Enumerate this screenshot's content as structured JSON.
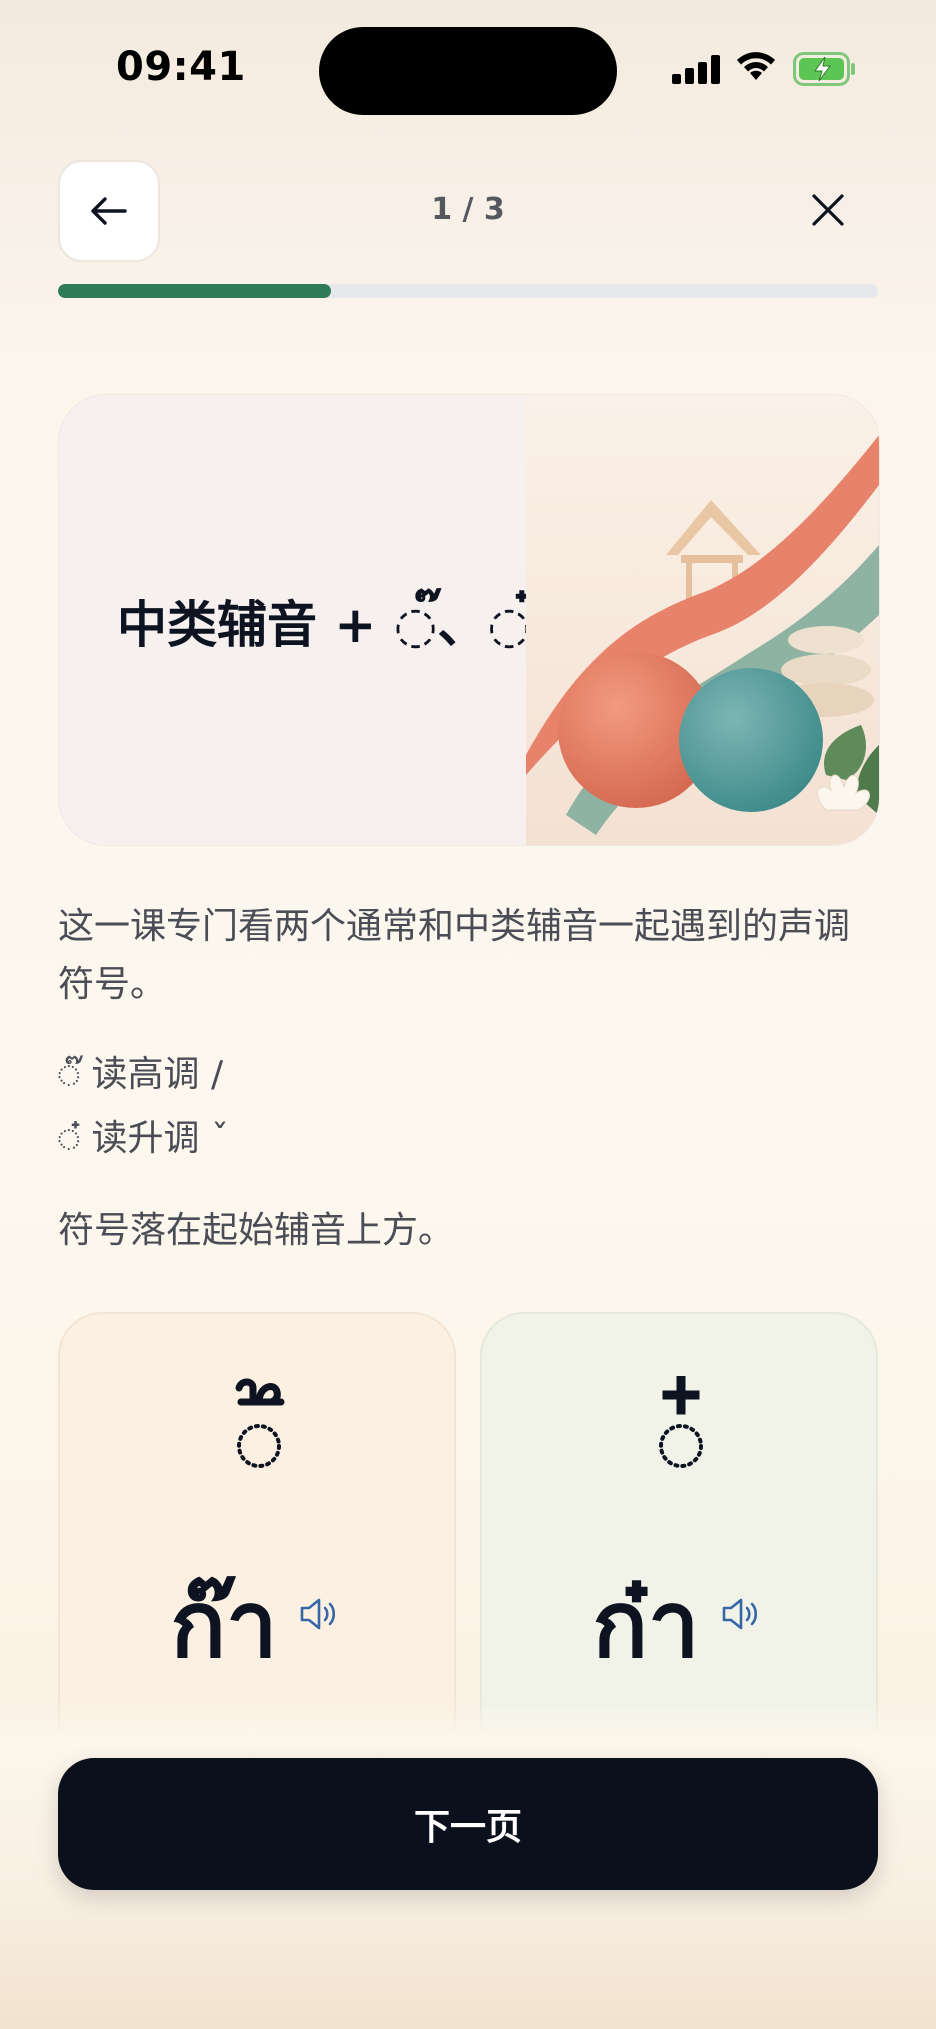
{
  "status_bar": {
    "time": "09:41"
  },
  "header": {
    "progress_text": "1 / 3",
    "progress_fraction": 0.333
  },
  "hero": {
    "title": "中类辅音 + ◌๊、◌๋"
  },
  "content": {
    "intro": "这一课专门看两个通常和中类辅音一起遇到的声调符号。",
    "rule_high_mark": "◌๊",
    "rule_high_text": " 读高调 /",
    "rule_rising_mark": "◌๋",
    "rule_rising_text": " 读升调 ˇ",
    "outro": "符号落在起始辅音上方。"
  },
  "cards": [
    {
      "word": "ก๊า"
    },
    {
      "word": "ก๋า"
    }
  ],
  "footer": {
    "next_label": "下一页"
  },
  "colors": {
    "accent_green": "#2f7a57",
    "button_dark": "#0b111c",
    "speaker_blue": "#3566a6"
  },
  "icons": [
    "arrow-left-icon",
    "close-icon",
    "speaker-icon"
  ]
}
